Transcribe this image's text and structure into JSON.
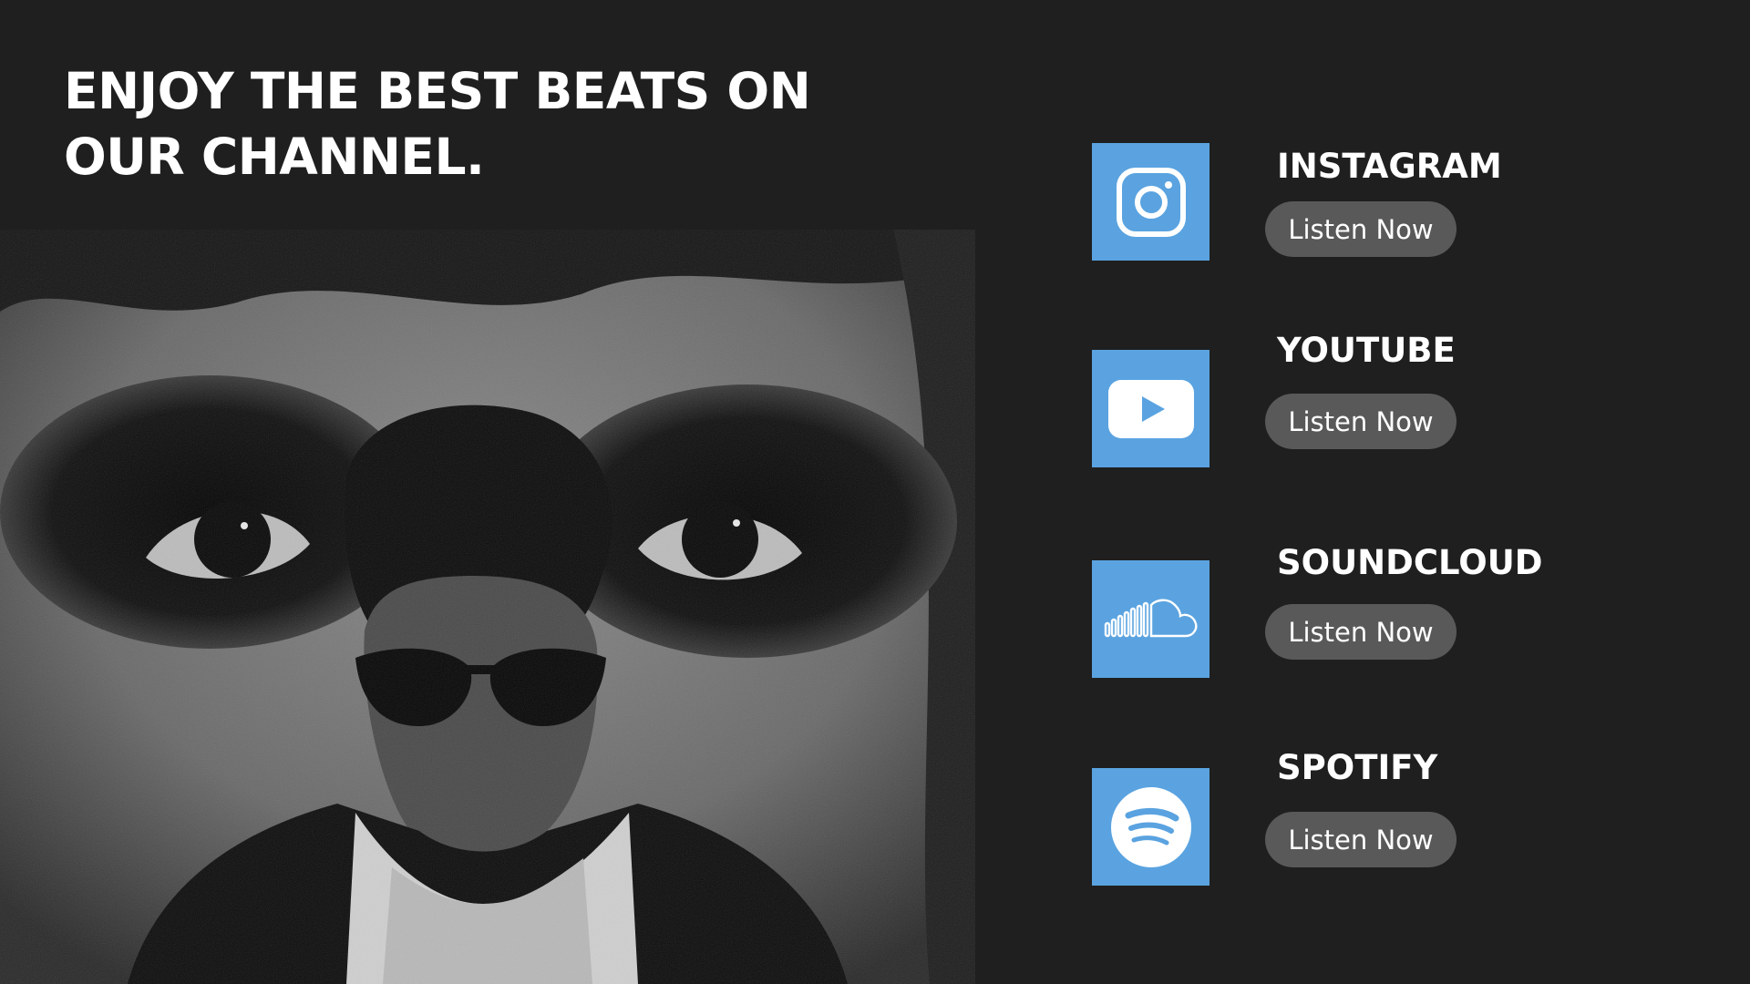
{
  "headline": "ENJOY THE BEST BEATS ON OUR CHANNEL.",
  "colors": {
    "background": "#1f1f1f",
    "tile": "#5aa3e0",
    "button": "#595959",
    "text": "#ffffff"
  },
  "platforms": [
    {
      "name": "INSTAGRAM",
      "icon": "instagram-icon",
      "cta": "Listen Now"
    },
    {
      "name": "YOUTUBE",
      "icon": "youtube-icon",
      "cta": "Listen Now"
    },
    {
      "name": "SOUNDCLOUD",
      "icon": "soundcloud-icon",
      "cta": "Listen Now"
    },
    {
      "name": "SPOTIFY",
      "icon": "spotify-icon",
      "cta": "Listen Now"
    }
  ]
}
